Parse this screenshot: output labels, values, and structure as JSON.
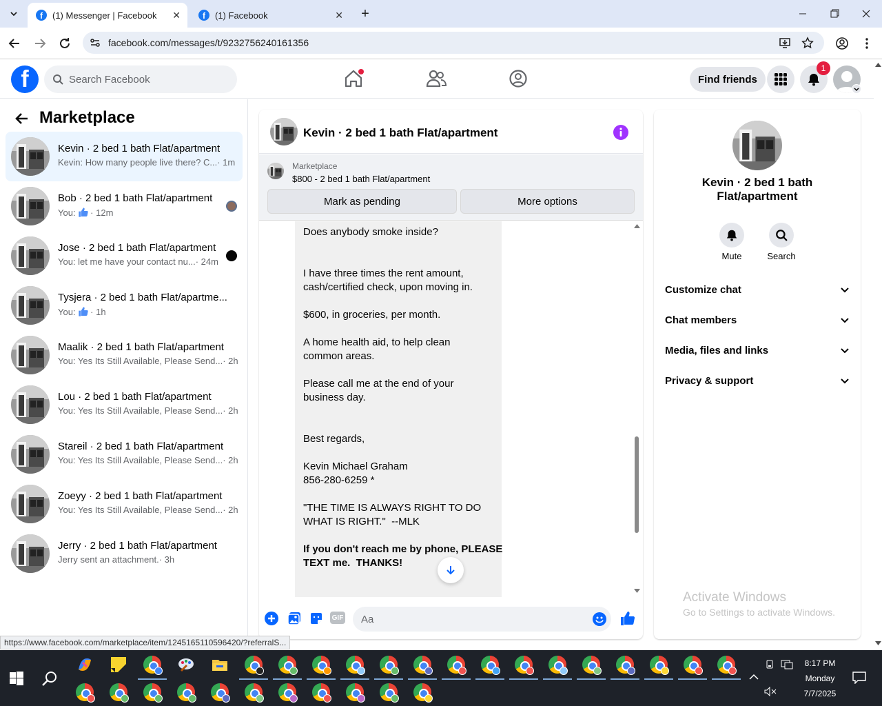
{
  "browser": {
    "tabs": [
      {
        "label": "(1) Messenger | Facebook",
        "active": true
      },
      {
        "label": "(1) Facebook",
        "active": false
      }
    ],
    "url": "facebook.com/messages/t/9232756240161356",
    "status_url": "https://www.facebook.com/marketplace/item/1245165110596420/?referralS..."
  },
  "header": {
    "search_placeholder": "Search Facebook",
    "find_friends_label": "Find friends",
    "notification_count": "1"
  },
  "sidebar": {
    "title": "Marketplace",
    "conversations": [
      {
        "name": "Kevin · 2 bed 1 bath Flat/apartment",
        "preview": "Kevin: How many people live there? C...",
        "time": "· 1m",
        "selected": true
      },
      {
        "name": "Bob · 2 bed 1 bath Flat/apartment",
        "preview": "You: ",
        "time": "· 12m",
        "like": true
      },
      {
        "name": "Jose · 2 bed 1 bath Flat/apartment",
        "preview": "You: let me have your contact nu...",
        "time": "· 24m",
        "unread": true
      },
      {
        "name": "Tysjera · 2 bed 1 bath Flat/apartme...",
        "preview": "You: ",
        "time": "· 1h",
        "like": true
      },
      {
        "name": "Maalik · 2 bed 1 bath Flat/apartment",
        "preview": "You: Yes Its Still Available, Please Send...",
        "time": "· 2h"
      },
      {
        "name": "Lou · 2 bed 1 bath Flat/apartment",
        "preview": "You: Yes Its Still Available, Please Send...",
        "time": "· 2h"
      },
      {
        "name": "Stareil · 2 bed 1 bath Flat/apartment",
        "preview": "You: Yes Its Still Available, Please Send...",
        "time": "· 2h"
      },
      {
        "name": "Zoeyy · 2 bed 1 bath Flat/apartment",
        "preview": "You: Yes Its Still Available, Please Send...",
        "time": "· 2h"
      },
      {
        "name": "Jerry · 2 bed 1 bath Flat/apartment",
        "preview": "Jerry sent an attachment.",
        "time": "· 3h"
      }
    ]
  },
  "chat": {
    "title": "Kevin · 2 bed 1 bath Flat/apartment",
    "marketplace_label": "Marketplace",
    "listing": "$800 - 2 bed 1 bath Flat/apartment",
    "mark_pending_label": "Mark as pending",
    "more_options_label": "More options",
    "message_lines": [
      "Does anybody smoke inside?",
      "",
      "",
      "I have three times the rent amount,",
      "cash/certified check, upon moving in.",
      "",
      "$600, in groceries, per month.",
      "",
      "A home health aid, to help clean",
      "common areas.",
      "",
      "Please call me at the end of your",
      "business day.",
      "",
      "",
      "Best regards,",
      "",
      "Kevin Michael Graham",
      "856-280-6259 *",
      "",
      "\"THE TIME IS ALWAYS RIGHT TO DO",
      "WHAT IS RIGHT.\"  --MLK",
      ""
    ],
    "message_bold_lines": [
      "If you don't reach me by phone, PLEASE",
      "TEXT me.  THANKS!"
    ],
    "composer_placeholder": "Aa"
  },
  "info_panel": {
    "name_line1": "Kevin · 2 bed 1 bath",
    "name_line2": "Flat/apartment",
    "mute_label": "Mute",
    "search_label": "Search",
    "sections": [
      "Customize chat",
      "Chat members",
      "Media, files and links",
      "Privacy & support"
    ]
  },
  "watermark": {
    "line1": "Activate Windows",
    "line2": "Go to Settings to activate Windows."
  },
  "taskbar": {
    "time": "8:17 PM",
    "day": "Monday",
    "date": "7/7/2025"
  },
  "colors": {
    "fb_blue": "#0866ff",
    "messenger_purple": "#a033ff",
    "selected_bg": "#ebf5ff",
    "taskbar_bg": "#1e2229"
  }
}
